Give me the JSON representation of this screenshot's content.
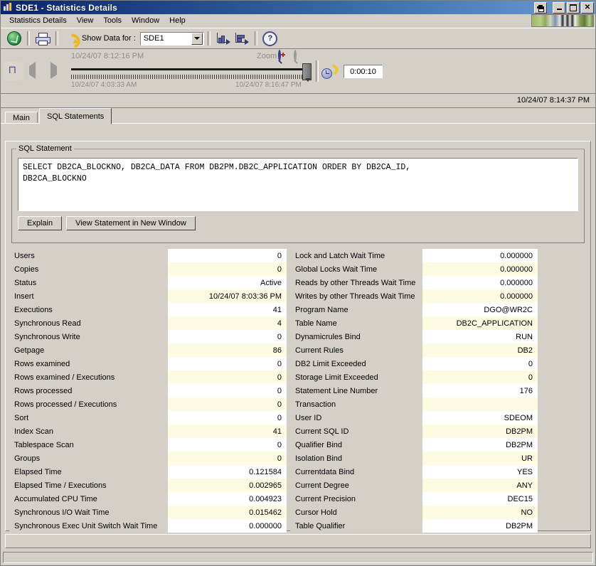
{
  "window": {
    "title": "SDE1 - Statistics Details",
    "icon": "statistics-icon",
    "buttons": {
      "print": "print-icon",
      "minimize": "minimize-icon",
      "maximize": "maximize-icon",
      "close": "close-icon"
    }
  },
  "menubar": {
    "items": [
      {
        "label": "Statistics Details"
      },
      {
        "label": "View"
      },
      {
        "label": "Tools"
      },
      {
        "label": "Window"
      },
      {
        "label": "Help"
      }
    ]
  },
  "toolbar": {
    "refresh_status_icon": "green-check-circle-icon",
    "print_icon": "printer-icon",
    "reload_icon": "yellow-refresh-arrow-icon",
    "show_data_label": "Show Data for :",
    "data_source": {
      "value": "SDE1",
      "options": [
        "SDE1"
      ]
    },
    "export_icon_1": "chart-export-icon",
    "export_icon_2": "chart-export-alt-icon",
    "help_icon": "question-mark-help-icon",
    "help_glyph": "?"
  },
  "timeline": {
    "history_icon": "history-column-icon",
    "back_icon": "arrow-left-icon",
    "forward_icon": "arrow-right-icon",
    "current_time": "10/24/07 8:12:16 PM",
    "zoom_label": "Zoom",
    "zoom_in_icon": "zoom-in-icon",
    "zoom_out_icon": "zoom-out-icon",
    "range_start": "10/24/07 4:03:33 AM",
    "range_end": "10/24/07 8:16:47 PM",
    "interval_icon": "refresh-interval-icon",
    "interval_value": "0:00:10"
  },
  "header": {
    "timestamp": "10/24/07 8:14:37 PM"
  },
  "tabs": [
    {
      "label": "Main",
      "active": false
    },
    {
      "label": "SQL Statements",
      "active": true
    }
  ],
  "sql_group": {
    "legend": "SQL Statement",
    "statement": "SELECT DB2CA_BLOCKNO, DB2CA_DATA FROM DB2PM.DB2C_APPLICATION ORDER BY DB2CA_ID,\nDB2CA_BLOCKNO",
    "buttons": {
      "explain": "Explain",
      "view_in_new_window": "View Statement in New Window"
    }
  },
  "stats_left": [
    {
      "label": "Users",
      "value": "0"
    },
    {
      "label": "Copies",
      "value": "0"
    },
    {
      "label": "Status",
      "value": "Active"
    },
    {
      "label": "Insert",
      "value": "10/24/07 8:03:36 PM"
    },
    {
      "label": "Executions",
      "value": "41"
    },
    {
      "label": "Synchronous Read",
      "value": "4"
    },
    {
      "label": "Synchronous Write",
      "value": "0"
    },
    {
      "label": "Getpage",
      "value": "86"
    },
    {
      "label": "Rows examined",
      "value": "0"
    },
    {
      "label": "Rows examined / Executions",
      "value": "0"
    },
    {
      "label": "Rows processed",
      "value": "0"
    },
    {
      "label": "Rows processed / Executions",
      "value": "0"
    },
    {
      "label": "Sort",
      "value": "0"
    },
    {
      "label": "Index Scan",
      "value": "41"
    },
    {
      "label": "Tablespace Scan",
      "value": "0"
    },
    {
      "label": "Groups",
      "value": "0"
    },
    {
      "label": "Elapsed Time",
      "value": "0.121584"
    },
    {
      "label": "Elapsed Time / Executions",
      "value": "0.002965"
    },
    {
      "label": "Accumulated CPU Time",
      "value": "0.004923"
    },
    {
      "label": "Synchronous I/O Wait Time",
      "value": "0.015462"
    },
    {
      "label": "Synchronous Exec Unit Switch Wait Time",
      "value": "0.000000"
    }
  ],
  "stats_right": [
    {
      "label": "Lock and Latch Wait Time",
      "value": "0.000000"
    },
    {
      "label": "Global Locks Wait Time",
      "value": "0.000000"
    },
    {
      "label": "Reads by other Threads Wait Time",
      "value": "0.000000"
    },
    {
      "label": "Writes by other Threads Wait Time",
      "value": "0.000000"
    },
    {
      "label": "Program Name",
      "value": "DGO@WR2C"
    },
    {
      "label": "Table Name",
      "value": "DB2C_APPLICATION"
    },
    {
      "label": "Dynamicrules Bind",
      "value": "RUN"
    },
    {
      "label": "Current Rules",
      "value": "DB2"
    },
    {
      "label": "DB2 Limit Exceeded",
      "value": "0"
    },
    {
      "label": "Storage Limit Exceeded",
      "value": "0"
    },
    {
      "label": "Statement Line Number",
      "value": "176"
    },
    {
      "label": "Transaction",
      "value": ""
    },
    {
      "label": "User ID",
      "value": "SDEOM"
    },
    {
      "label": "Current SQL ID",
      "value": "DB2PM"
    },
    {
      "label": "Qualifier Bind",
      "value": "DB2PM"
    },
    {
      "label": "Isolation Bind",
      "value": "UR"
    },
    {
      "label": "Currentdata Bind",
      "value": "YES"
    },
    {
      "label": "Current Degree",
      "value": "ANY"
    },
    {
      "label": "Current Precision",
      "value": "DEC15"
    },
    {
      "label": "Cursor Hold",
      "value": "NO"
    },
    {
      "label": "Table Qualifier",
      "value": "DB2PM"
    }
  ],
  "colors": {
    "title_gradient_start": "#0a246a",
    "title_gradient_end": "#6d9ad6",
    "window_face": "#d4d0c8",
    "row_even": "#ffffff",
    "row_odd": "#fdfce3",
    "accent_navy": "#33356b"
  }
}
